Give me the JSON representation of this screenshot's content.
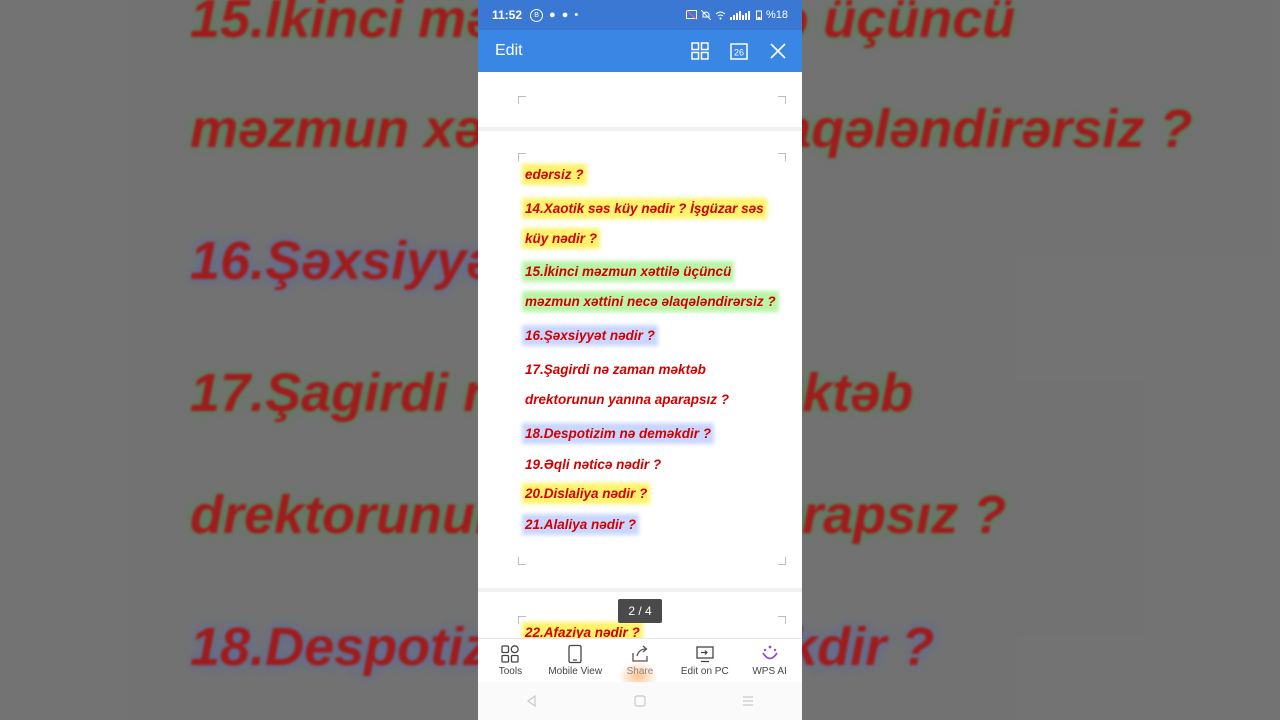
{
  "background": {
    "lines": [
      {
        "text": "15.İkinci məzmun xəttilə üçüncü",
        "tone": "green"
      },
      {
        "text": "məzmun xəttini necə əlaqələndirərsiz ?",
        "tone": "green"
      },
      {
        "text": "16.Şəxsiyyət nədir ?",
        "tone": "blue"
      },
      {
        "text": "17.Şagirdi nə  zaman məktəb",
        "tone": "green"
      },
      {
        "text": "drektorunun yanına aparарsız ?",
        "tone": "green"
      },
      {
        "text": "18.Despotizim nə deməkdir ?",
        "tone": "blue"
      }
    ]
  },
  "status_bar": {
    "time": "11:52",
    "left_icons": [
      "b-icon",
      "snapchat-icon",
      "snapchat-icon",
      "dot-icon"
    ],
    "right_text": "%18"
  },
  "app_bar": {
    "title": "Edit",
    "icons": [
      "grid-icon",
      "calendar-icon",
      "close-icon"
    ],
    "calendar_number": "26"
  },
  "document": {
    "lines": [
      {
        "text": "edərsiz ?",
        "highlight": "yellow"
      },
      {
        "text": "14.Xaotik səs küy nədir ? İşgüzar səs",
        "highlight": "yellow"
      },
      {
        "text": "küy nədir ?",
        "highlight": "yellow"
      },
      {
        "text": "15.İkinci məzmun xəttilə üçüncü",
        "highlight": "green"
      },
      {
        "text": "məzmun xəttini necə əlaqələndirərsiz ?",
        "highlight": "green"
      },
      {
        "text": "16.Şəxsiyyət nədir ?",
        "highlight": "blue"
      },
      {
        "text": "17.Şagirdi nə  zaman məktəb",
        "highlight": "none"
      },
      {
        "text": "drektorunun yanına aparарsız ?",
        "highlight": "none"
      },
      {
        "text": "18.Despotizim nə deməkdir ?",
        "highlight": "blue"
      },
      {
        "text": "19.Əqli nəticə nədir ?",
        "highlight": "none"
      },
      {
        "text": "20.Dislaliya nədir ?",
        "highlight": "yellow"
      },
      {
        "text": "21.Alaliya nədir ?",
        "highlight": "blue"
      },
      {
        "text": "22.Afaziya nədir ?",
        "highlight": "yellow"
      }
    ],
    "page_indicator": "2 / 4"
  },
  "toolbar": {
    "items": [
      {
        "label": "Tools",
        "icon": "tools-icon"
      },
      {
        "label": "Mobile View",
        "icon": "mobile-view-icon"
      },
      {
        "label": "Share",
        "icon": "share-icon"
      },
      {
        "label": "Edit on PC",
        "icon": "edit-on-pc-icon"
      },
      {
        "label": "WPS AI",
        "icon": "wps-ai-icon"
      }
    ]
  },
  "nav_bar": {
    "icons": [
      "back-icon",
      "home-icon",
      "recents-icon"
    ]
  },
  "colors": {
    "app_bar": "#3a86e4",
    "status_bar": "#3a78d4",
    "text_red": "#d40000",
    "highlight_yellow": "#fff36b",
    "highlight_green": "#b8f5a8",
    "highlight_blue": "#c9d7ff"
  }
}
